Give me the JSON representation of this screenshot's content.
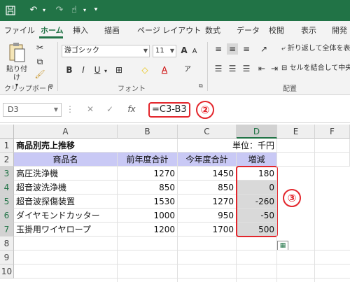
{
  "accent": "#217346",
  "highlight": "#e3262c",
  "qat": {
    "save_icon": "save-icon",
    "undo_icon": "undo-icon",
    "redo_icon": "redo-icon",
    "touch_icon": "touch-mode-icon",
    "customize_icon": "customize-qat-icon"
  },
  "tabs": [
    "ファイル",
    "ホーム",
    "挿入",
    "描画",
    "ページ レイアウト",
    "数式",
    "データ",
    "校閲",
    "表示",
    "開発"
  ],
  "ribbon": {
    "clipboard": {
      "paste_label": "貼り付け",
      "group_label": "クリップボード"
    },
    "font": {
      "font_name": "游ゴシック",
      "font_size": "11",
      "grow": "A",
      "shrink": "A",
      "bold": "B",
      "italic": "I",
      "underline": "U",
      "font_color": "A",
      "group_label": "フォント"
    },
    "alignment": {
      "wrap_text": "折り返して全体を表",
      "merge_center": "セルを結合して中央",
      "group_label": "配置"
    }
  },
  "formula_bar": {
    "name_box": "D3",
    "cancel": "✕",
    "enter": "✓",
    "fx": "fx",
    "formula": "=C3-B3",
    "callout": "②"
  },
  "callout_range": "③",
  "columns": [
    "A",
    "B",
    "C",
    "D",
    "E",
    "F"
  ],
  "rows": [
    "1",
    "2",
    "3",
    "4",
    "5",
    "6",
    "7",
    "8",
    "9",
    "10"
  ],
  "sheet": {
    "title": "商品別売上推移",
    "unit": "単位：千円",
    "headers": [
      "商品名",
      "前年度合計",
      "今年度合計",
      "増減"
    ],
    "data": [
      [
        "高圧洗浄機",
        "1270",
        "1450",
        "180"
      ],
      [
        "超音波洗浄機",
        "850",
        "850",
        "0"
      ],
      [
        "超音波探傷装置",
        "1530",
        "1270",
        "-260"
      ],
      [
        "ダイヤモンドカッター",
        "1000",
        "950",
        "-50"
      ],
      [
        "玉掛用ワイヤロープ",
        "1200",
        "1700",
        "500"
      ]
    ]
  }
}
